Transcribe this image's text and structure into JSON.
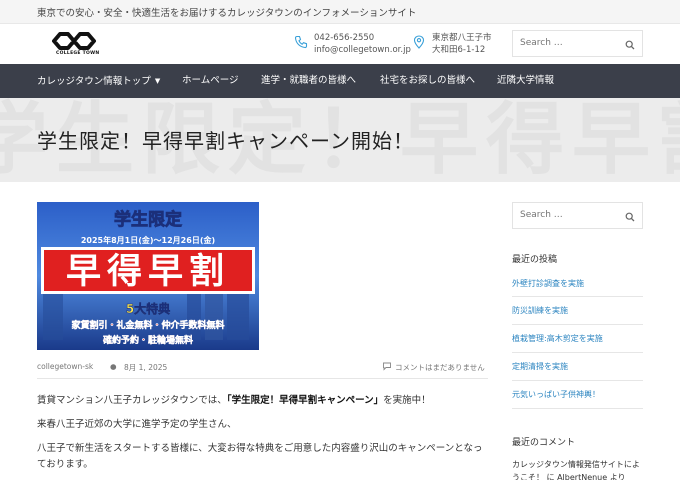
{
  "topbar": {
    "tagline": "東京での安心・安全・快適生活をお届けするカレッジタウンのインフォメーションサイト"
  },
  "header": {
    "logo_text": "COLLEGE TOWN",
    "phone": "042-656-2550",
    "email": "info@collegetown.or.jp",
    "address_line1": "東京都八王子市",
    "address_line2": "大和田6-1-12",
    "search_placeholder": "Search …"
  },
  "nav": {
    "items": [
      {
        "label": "カレッジタウン情報トップ",
        "has_dropdown": true
      },
      {
        "label": "ホームページ"
      },
      {
        "label": "進学・就職者の皆様へ"
      },
      {
        "label": "社宅をお探しの皆様へ"
      },
      {
        "label": "近隣大学情報"
      }
    ]
  },
  "hero": {
    "title": "学生限定！早得早割キャンペーン開始！"
  },
  "featured_image": {
    "line1": "学生限定",
    "line2": "2025年8月1日(金)～12月26日(金)",
    "line3": "早得早割",
    "line4": "5大特典",
    "line5": "家賃割引・礼金無料・仲介手数料無料",
    "line6": "確約予約・駐輪場無料"
  },
  "post_meta": {
    "author": "collegetown-sk",
    "date": "8月 1, 2025",
    "comments": "コメントはまだありません"
  },
  "content": {
    "p1_before": "賃貸マンション八王子カレッジタウンでは、",
    "p1_strong": "「学生限定！早得早割キャンペーン」",
    "p1_after": "を実施中！",
    "p2": "来春八王子近郊の大学に進学予定の学生さん、",
    "p3": "八王子で新生活をスタートする皆様に、大変お得な特典をご用意した内容盛り沢山のキャンペーンとなっております。"
  },
  "sidebar": {
    "search_placeholder": "Search …",
    "recent_posts_title": "最近の投稿",
    "recent_posts": [
      "外壁打診調査を実施",
      "防災訓練を実施",
      "植栽管理:高木剪定を実施",
      "定期清掃を実施",
      "元気いっぱい子供神輿！"
    ],
    "recent_comments_title": "最近のコメント",
    "comment_text": "カレッジタウン情報発信サイトにようこそ！ に AlbertNenue より"
  },
  "colors": {
    "nav_bg": "#3b3f4a",
    "link": "#2e86c1",
    "hero_bg": "#ececec"
  }
}
